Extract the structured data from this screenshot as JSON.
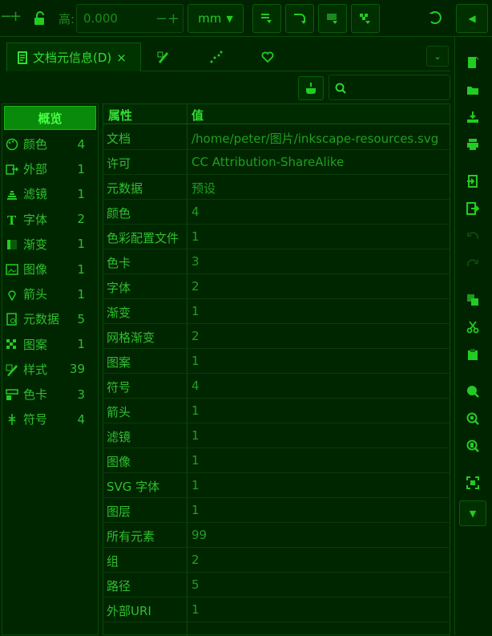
{
  "toolbar": {
    "height_label": "高:",
    "height_value": "0.000",
    "unit": "mm"
  },
  "dialog": {
    "tab_title": "文档元信息(D)",
    "tab_close": "×",
    "search": {
      "placeholder": ""
    }
  },
  "categories": {
    "overview": "概览",
    "items": [
      {
        "label": "颜色",
        "count": "4",
        "icon": "palette-icon"
      },
      {
        "label": "外部",
        "count": "1",
        "icon": "external-icon"
      },
      {
        "label": "滤镜",
        "count": "1",
        "icon": "filter-icon"
      },
      {
        "label": "字体",
        "count": "2",
        "icon": "font-icon"
      },
      {
        "label": "渐变",
        "count": "1",
        "icon": "gradient-icon"
      },
      {
        "label": "图像",
        "count": "1",
        "icon": "image-icon"
      },
      {
        "label": "箭头",
        "count": "1",
        "icon": "marker-icon"
      },
      {
        "label": "元数据",
        "count": "5",
        "icon": "metadata-icon"
      },
      {
        "label": "图案",
        "count": "1",
        "icon": "pattern-icon"
      },
      {
        "label": "样式",
        "count": "39",
        "icon": "style-icon"
      },
      {
        "label": "色卡",
        "count": "3",
        "icon": "swatch-icon"
      },
      {
        "label": "符号",
        "count": "4",
        "icon": "symbol-icon"
      }
    ]
  },
  "table": {
    "headers": {
      "property": "属性",
      "value": "值"
    },
    "rows": [
      {
        "k": "文档",
        "v": "/home/peter/图片/inkscape-resources.svg"
      },
      {
        "k": "许可",
        "v": "CC Attribution-ShareAlike"
      },
      {
        "k": "元数据",
        "v": "预设"
      },
      {
        "k": "颜色",
        "v": "4"
      },
      {
        "k": "色彩配置文件",
        "v": "1"
      },
      {
        "k": "色卡",
        "v": "3"
      },
      {
        "k": "字体",
        "v": "2"
      },
      {
        "k": "渐变",
        "v": "1"
      },
      {
        "k": "网格渐变",
        "v": "2"
      },
      {
        "k": "图案",
        "v": "1"
      },
      {
        "k": "符号",
        "v": "4"
      },
      {
        "k": "箭头",
        "v": "1"
      },
      {
        "k": "滤镜",
        "v": "1"
      },
      {
        "k": "图像",
        "v": "1"
      },
      {
        "k": "SVG 字体",
        "v": "1"
      },
      {
        "k": "图层",
        "v": "1"
      },
      {
        "k": "所有元素",
        "v": "99"
      },
      {
        "k": "组",
        "v": "2"
      },
      {
        "k": "路径",
        "v": "5"
      },
      {
        "k": "外部URI",
        "v": "1"
      }
    ]
  }
}
